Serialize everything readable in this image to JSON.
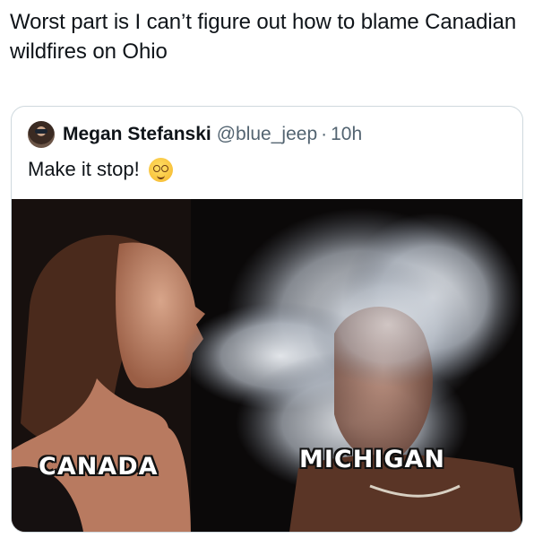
{
  "post": {
    "text": "Worst part is I can’t figure out how to blame Canadian wildfires on Ohio"
  },
  "quoted_tweet": {
    "author_name": "Megan Stefanski",
    "handle": "@blue_jeep",
    "separator": "·",
    "time": "10h",
    "text": "Make it stop!",
    "emoji": "woozy-face-emoji",
    "avatar": "user-avatar"
  },
  "media": {
    "caption_left": "CANADA",
    "caption_right": "MICHIGAN"
  }
}
